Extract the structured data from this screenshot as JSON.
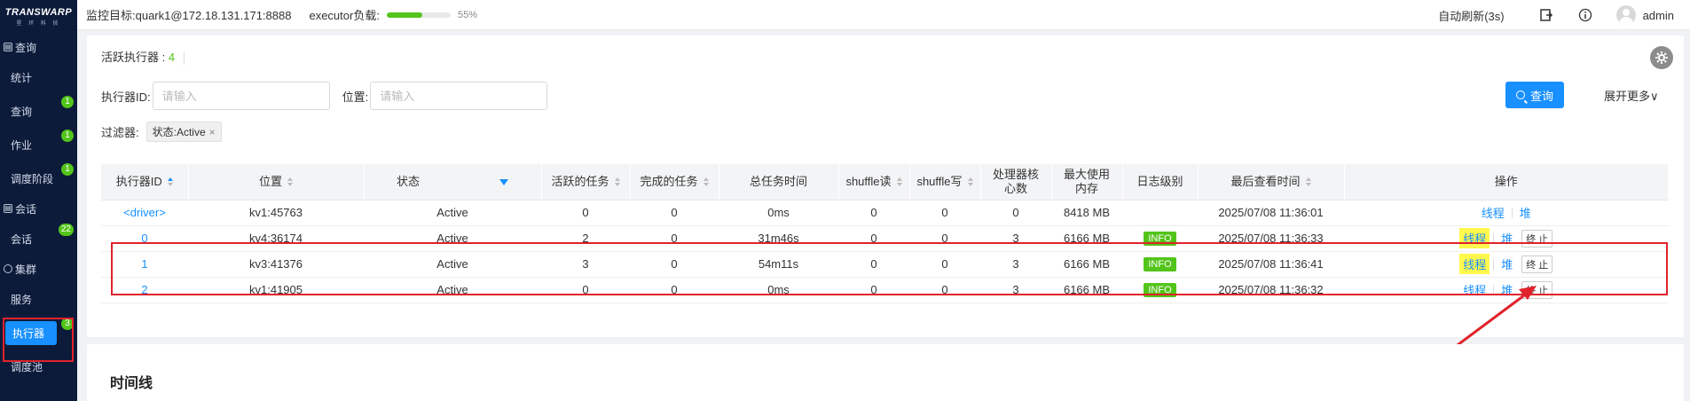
{
  "sidebar": {
    "logo_text": "TRANSWARP",
    "logo_sub": "星 环 科 技",
    "sections": [
      {
        "label": "查询",
        "items": [
          {
            "label": "统计",
            "badge": ""
          },
          {
            "label": "查询",
            "badge": "1"
          },
          {
            "label": "作业",
            "badge": "1"
          },
          {
            "label": "调度阶段",
            "badge": "1"
          }
        ]
      },
      {
        "label": "会话",
        "items": [
          {
            "label": "会话",
            "badge": "22"
          }
        ]
      },
      {
        "label": "集群",
        "items": [
          {
            "label": "服务",
            "badge": ""
          },
          {
            "label": "执行器",
            "badge": "3",
            "active": true
          },
          {
            "label": "调度池",
            "badge": ""
          }
        ]
      }
    ]
  },
  "header": {
    "monitor_target": "监控目标:quark1@172.18.131.171:8888",
    "executor_load_label": "executor负载:",
    "executor_load_fraction": 0.55,
    "executor_load_text": "55%",
    "auto_refresh": "自动刷新(3s)",
    "username": "admin"
  },
  "main": {
    "active_executors_label": "活跃执行器 : ",
    "active_executors_count": "4",
    "executor_id_label": "执行器ID:",
    "executor_id_placeholder": "请输入",
    "location_label": "位置:",
    "location_placeholder": "请输入",
    "query_button": "查询",
    "expand_more": "展开更多",
    "filter_label": "过滤器:",
    "filter_tag": "状态:Active",
    "table": {
      "columns": [
        "执行器ID",
        "位置",
        "状态",
        "活跃的任务",
        "完成的任务",
        "总任务时间",
        "shuffle读",
        "shuffle写",
        "处理器核心数",
        "最大使用内存",
        "日志级别",
        "最后查看时间",
        "操作"
      ],
      "rows": [
        {
          "id": "<driver>",
          "location": "kv1:45763",
          "status": "Active",
          "active_tasks": "0",
          "done_tasks": "0",
          "total_time": "0ms",
          "shuffle_read": "0",
          "shuffle_write": "0",
          "cores": "0",
          "max_mem": "8418 MB",
          "log_level": "",
          "last_seen": "2025/07/08 11:36:01",
          "op_thread": "线程",
          "op_heap": "堆",
          "op_stop": ""
        },
        {
          "id": "0",
          "location": "kv4:36174",
          "status": "Active",
          "active_tasks": "2",
          "done_tasks": "0",
          "total_time": "31m46s",
          "shuffle_read": "0",
          "shuffle_write": "0",
          "cores": "3",
          "max_mem": "6166 MB",
          "log_level": "INFO",
          "last_seen": "2025/07/08 11:36:33",
          "op_thread": "线程",
          "op_heap": "堆",
          "op_stop": "终 止"
        },
        {
          "id": "1",
          "location": "kv3:41376",
          "status": "Active",
          "active_tasks": "3",
          "done_tasks": "0",
          "total_time": "54m11s",
          "shuffle_read": "0",
          "shuffle_write": "0",
          "cores": "3",
          "max_mem": "6166 MB",
          "log_level": "INFO",
          "last_seen": "2025/07/08 11:36:41",
          "op_thread": "线程",
          "op_heap": "堆",
          "op_stop": "终 止"
        },
        {
          "id": "2",
          "location": "kv1:41905",
          "status": "Active",
          "active_tasks": "0",
          "done_tasks": "0",
          "total_time": "0ms",
          "shuffle_read": "0",
          "shuffle_write": "0",
          "cores": "3",
          "max_mem": "6166 MB",
          "log_level": "INFO",
          "last_seen": "2025/07/08 11:36:32",
          "op_thread": "线程",
          "op_heap": "堆",
          "op_stop": "终 止"
        }
      ]
    },
    "timeline_title": "时间线"
  },
  "colors": {
    "sidebar_bg": "#0d1b3a",
    "accent": "#1890ff",
    "success": "#52c41a",
    "annotation_red": "#e0232b",
    "highlight_yellow": "#fff84d"
  }
}
